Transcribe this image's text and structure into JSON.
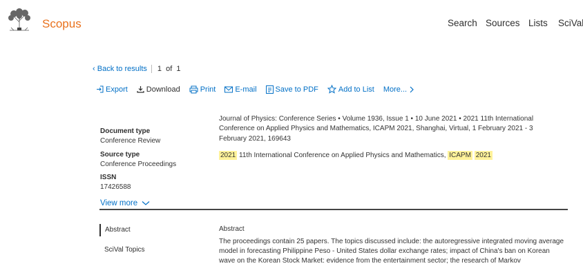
{
  "header": {
    "brand": "Scopus",
    "nav": [
      "Search",
      "Sources",
      "Lists",
      "SciVal"
    ]
  },
  "nav_bar": {
    "back_label": "Back to results",
    "pagination": "1  of  1"
  },
  "actions": {
    "export": "Export",
    "download": "Download",
    "print": "Print",
    "email": "E-mail",
    "save_pdf": "Save to PDF",
    "add_list": "Add to List",
    "more": "More..."
  },
  "citation": "Journal of Physics: Conference Series  •  Volume 1936, Issue 1  •  10 June 2021  •  2021 11th International Conference on Applied Physics and Mathematics, ICAPM 2021, Shanghai, Virtual, 1 February 2021 - 3 February 2021, 169643",
  "conference": {
    "year": "2021",
    "name": "11th International Conference on Applied Physics and Mathematics,",
    "acronym": "ICAPM",
    "year2": "2021"
  },
  "meta": {
    "doc_type_label": "Document type",
    "doc_type_value": "Conference Review",
    "source_type_label": "Source type",
    "source_type_value": "Conference Proceedings",
    "issn_label": "ISSN",
    "issn_value": "17426588",
    "view_more": "View more"
  },
  "sidebar": {
    "abstract": "Abstract",
    "scival": "SciVal Topics"
  },
  "abstract": {
    "title": "Abstract",
    "text": "The proceedings contain 25 papers. The topics discussed include: the autoregressive integrated moving average model in forecasting Philippine Peso - United States dollar exchange rates; impact of China's ban on Korean wave on the Korean Stock Market: evidence from the entertainment sector; the research of Markov"
  },
  "colors": {
    "brand": "#e9711c",
    "link": "#006fc6",
    "highlight": "#fff29a"
  }
}
